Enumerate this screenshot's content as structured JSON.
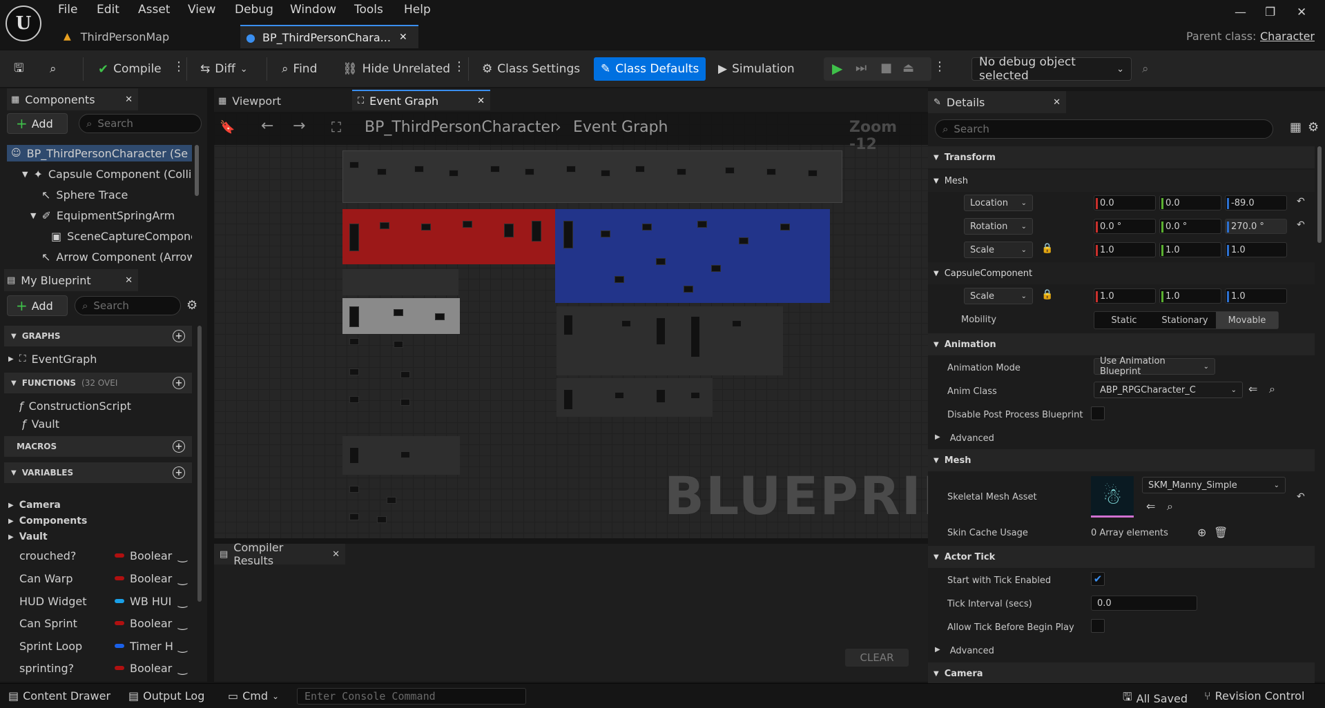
{
  "menu": [
    "File",
    "Edit",
    "Asset",
    "View",
    "Debug",
    "Window",
    "Tools",
    "Help"
  ],
  "tabs": [
    {
      "label": "ThirdPersonMap"
    },
    {
      "label": "BP_ThirdPersonChara..."
    }
  ],
  "parent_class": {
    "label": "Parent class:",
    "value": "Character"
  },
  "toolbar": {
    "compile": "Compile",
    "diff": "Diff",
    "find": "Find",
    "hide_unrelated": "Hide Unrelated",
    "class_settings": "Class Settings",
    "class_defaults": "Class Defaults",
    "simulation": "Simulation",
    "debug_object": "No debug object selected"
  },
  "components": {
    "title": "Components",
    "add": "Add",
    "search_placeholder": "Search",
    "items": [
      "BP_ThirdPersonCharacter (Se",
      "Capsule Component (Colli",
      "Sphere Trace",
      "EquipmentSpringArm",
      "SceneCaptureCompone",
      "Arrow Component (Arrow"
    ]
  },
  "my_blueprint": {
    "title": "My Blueprint",
    "add": "Add",
    "search_placeholder": "Search",
    "graphs": "GRAPHS",
    "event_graph": "EventGraph",
    "functions": "FUNCTIONS",
    "functions_count": "(32 OVEI",
    "func_items": [
      "ConstructionScript",
      "Vault"
    ],
    "macros": "MACROS",
    "variables": "VARIABLES",
    "var_groups": [
      "Camera",
      "Components",
      "Vault"
    ],
    "vars": [
      {
        "name": "crouched?",
        "type": "Boolear",
        "color": "#b01010"
      },
      {
        "name": "Can Warp",
        "type": "Boolear",
        "color": "#b01010"
      },
      {
        "name": "HUD Widget",
        "type": "WB HUI",
        "color": "#1aa0e8"
      },
      {
        "name": "Can Sprint",
        "type": "Boolear",
        "color": "#b01010"
      },
      {
        "name": "Sprint Loop",
        "type": "Timer H",
        "color": "#1a60e8"
      },
      {
        "name": "sprinting?",
        "type": "Boolear",
        "color": "#b01010"
      }
    ]
  },
  "graph_tabs": {
    "viewport": "Viewport",
    "event_graph": "Event Graph"
  },
  "graph": {
    "crumb_bp": "BP_ThirdPersonCharacter",
    "crumb_graph": "Event Graph",
    "zoom": "Zoom -12",
    "watermark": "BLUEPRINT"
  },
  "compiler": {
    "title": "Compiler Results",
    "clear": "CLEAR"
  },
  "details": {
    "title": "Details",
    "search_placeholder": "Search",
    "transform": "Transform",
    "mesh_sub": "Mesh",
    "location": {
      "label": "Location",
      "x": "0.0",
      "y": "0.0",
      "z": "-89.0"
    },
    "rotation": {
      "label": "Rotation",
      "x": "0.0 °",
      "y": "0.0 °",
      "z": "270.0 °"
    },
    "scale": {
      "label": "Scale",
      "x": "1.0",
      "y": "1.0",
      "z": "1.0"
    },
    "capsule": "CapsuleComponent",
    "capsule_scale": {
      "label": "Scale",
      "x": "1.0",
      "y": "1.0",
      "z": "1.0"
    },
    "mobility": {
      "label": "Mobility",
      "options": [
        "Static",
        "Stationary",
        "Movable"
      ],
      "selected": "Movable"
    },
    "animation": "Animation",
    "anim_mode": {
      "label": "Animation Mode",
      "value": "Use Animation Blueprint"
    },
    "anim_class": {
      "label": "Anim Class",
      "value": "ABP_RPGCharacter_C"
    },
    "disable_ppb": {
      "label": "Disable Post Process Blueprint"
    },
    "advanced": "Advanced",
    "mesh": "Mesh",
    "skeletal": {
      "label": "Skeletal Mesh Asset",
      "value": "SKM_Manny_Simple"
    },
    "skin_cache": {
      "label": "Skin Cache Usage",
      "value": "0 Array elements"
    },
    "actor_tick": "Actor Tick",
    "start_tick": {
      "label": "Start with Tick Enabled"
    },
    "tick_interval": {
      "label": "Tick Interval (secs)",
      "value": "0.0"
    },
    "allow_tick": {
      "label": "Allow Tick Before Begin Play"
    },
    "advanced2": "Advanced",
    "camera": "Camera"
  },
  "status": {
    "content_drawer": "Content Drawer",
    "output_log": "Output Log",
    "cmd": "Cmd",
    "console_placeholder": "Enter Console Command",
    "all_saved": "All Saved",
    "revision": "Revision Control"
  }
}
